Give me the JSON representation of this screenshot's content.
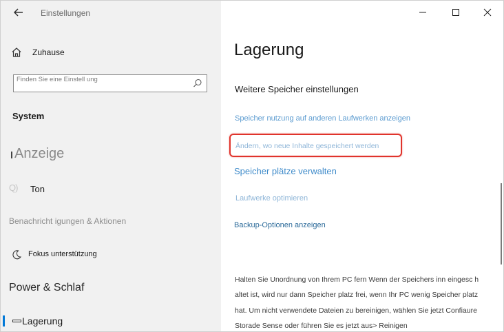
{
  "window": {
    "title": "Einstellungen",
    "controls": {
      "minimize": "minimize",
      "maximize": "maximize",
      "close": "close"
    }
  },
  "sidebar": {
    "home_label": "Zuhause",
    "search_placeholder": "Finden Sie eine Einstell ung",
    "section_title": "System",
    "items": [
      {
        "label": "Anzeige",
        "icon": "display-icon"
      },
      {
        "label": "Ton",
        "icon": "sound-icon"
      },
      {
        "label": "Benachricht igungen & Aktionen",
        "icon": ""
      },
      {
        "label": "Fokus unterstützung",
        "icon": "moon-icon"
      },
      {
        "label": "Power & Schlaf",
        "icon": ""
      },
      {
        "label": "Lagerung",
        "icon": "storage-icon",
        "selected": true
      }
    ]
  },
  "main": {
    "page_title": "Lagerung",
    "subheading": "Weitere Speicher einstellungen",
    "links": {
      "usage_other_drives": "Speicher nutzung auf anderen Laufwerken anzeigen",
      "change_save_location": "Ändern, wo neue Inhalte gespeichert werden",
      "storage_pools": "Speicher plätze verwalten",
      "optimize_drives": "Laufwerke optimieren",
      "backup_options": "Backup-Optionen anzeigen"
    },
    "description_lines": [
      "Halten Sie Unordnung von Ihrem PC fern Wenn der Speichers inn eingesc h",
      "altet ist, wird nur dann Speicher platz frei, wenn Ihr PC wenig Speicher platz",
      "hat. Um nicht verwendete Dateien zu bereinigen, wählen Sie jetzt Confiaure",
      "Storade Sense oder führen Sie es jetzt aus> Reinigen"
    ]
  },
  "colors": {
    "accent": "#0078d7",
    "link": "#3f8bca",
    "highlight": "#e0342c",
    "sidebar_bg": "#f1f1f1"
  }
}
